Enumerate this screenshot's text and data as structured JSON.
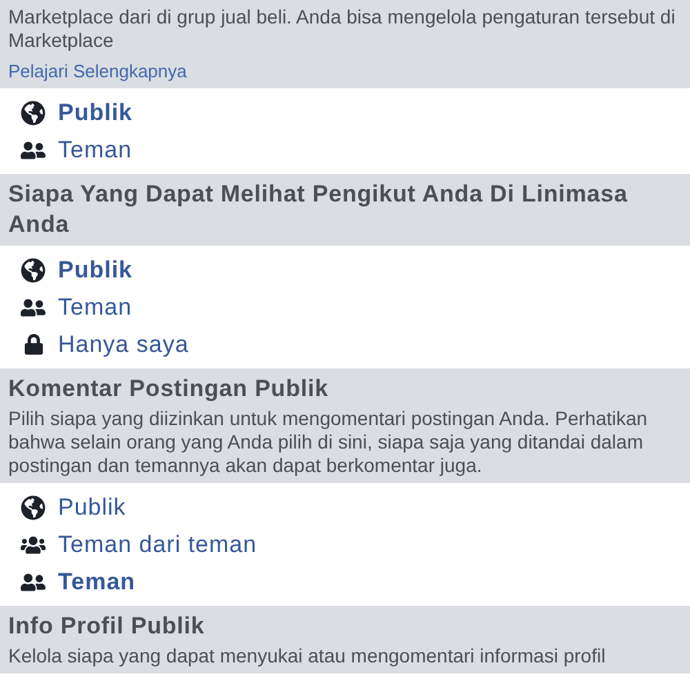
{
  "sections": [
    {
      "description": "Marketplace dari di grup jual beli. Anda bisa mengelola pengaturan tersebut di Marketplace",
      "link": "Pelajari Selengkapnya",
      "options": [
        {
          "kind": "public",
          "label": "Publik",
          "selected": true
        },
        {
          "kind": "friends",
          "label": "Teman",
          "selected": false
        }
      ]
    },
    {
      "heading": "Siapa Yang Dapat Melihat Pengikut Anda Di Linimasa Anda",
      "options": [
        {
          "kind": "public",
          "label": "Publik",
          "selected": true
        },
        {
          "kind": "friends",
          "label": "Teman",
          "selected": false
        },
        {
          "kind": "only_me",
          "label": "Hanya saya",
          "selected": false
        }
      ]
    },
    {
      "heading": "Komentar Postingan Publik",
      "description": "Pilih siapa yang diizinkan untuk mengomentari postingan Anda. Perhatikan bahwa selain orang yang Anda pilih di sini, siapa saja yang ditandai dalam postingan dan temannya akan dapat berkomentar juga.",
      "options": [
        {
          "kind": "public",
          "label": "Publik",
          "selected": false
        },
        {
          "kind": "friends_of_friends",
          "label": "Teman dari teman",
          "selected": false
        },
        {
          "kind": "friends",
          "label": "Teman",
          "selected": true
        }
      ]
    },
    {
      "heading": "Info Profil Publik",
      "description": "Kelola siapa yang dapat menyukai atau mengomentari informasi profil"
    }
  ]
}
